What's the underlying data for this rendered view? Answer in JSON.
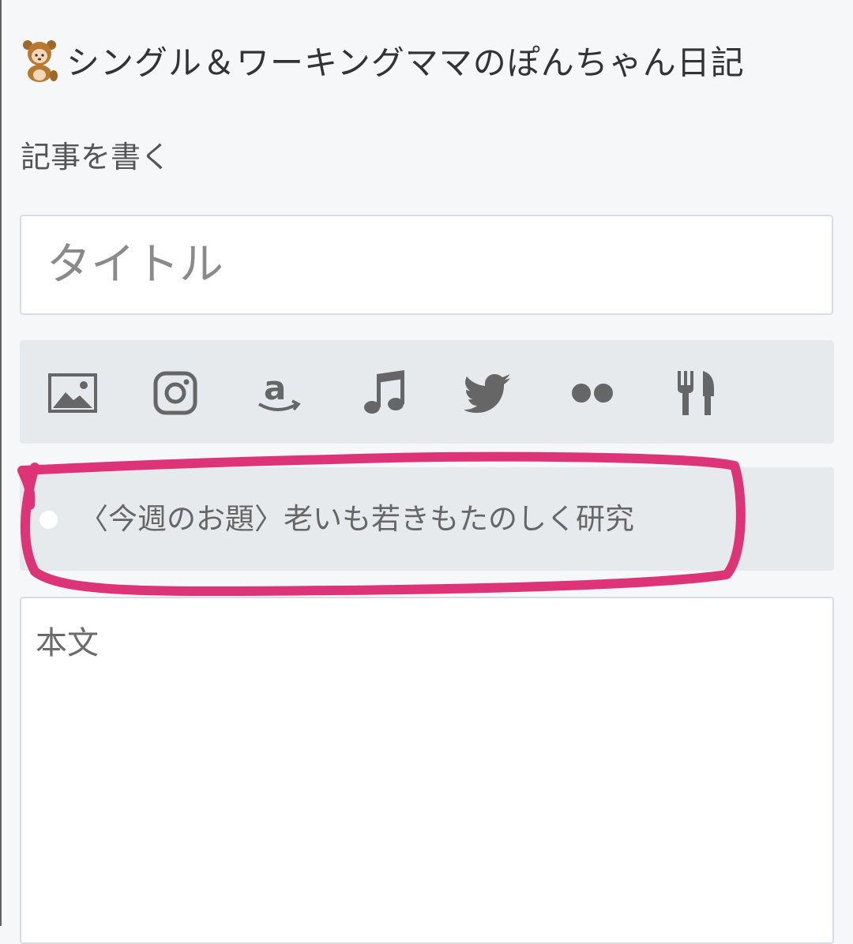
{
  "header": {
    "blog_title": "シングル＆ワーキングママのぽんちゃん日記"
  },
  "editor": {
    "section_label": "記事を書く",
    "title_placeholder": "タイトル",
    "body_placeholder": "本文"
  },
  "toolbar": {
    "items": [
      {
        "icon": "image-icon",
        "label": "image"
      },
      {
        "icon": "instagram-icon",
        "label": "instagram"
      },
      {
        "icon": "amazon-icon",
        "label": "amazon"
      },
      {
        "icon": "music-icon",
        "label": "music"
      },
      {
        "icon": "twitter-icon",
        "label": "twitter"
      },
      {
        "icon": "flickr-icon",
        "label": "flickr"
      },
      {
        "icon": "restaurant-icon",
        "label": "restaurant"
      }
    ]
  },
  "topic": {
    "text": "〈今週のお題〉老いも若きもたのしく研究"
  },
  "colors": {
    "background": "#f6f7f9",
    "toolbar_bg": "#e7eaed",
    "icon_gray": "#666666",
    "highlight_pink": "#dd3377"
  }
}
